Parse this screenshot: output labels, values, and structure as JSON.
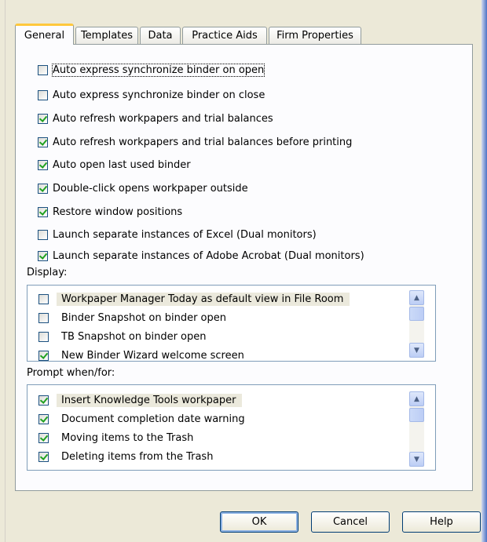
{
  "tabs": [
    {
      "label": "General",
      "active": true
    },
    {
      "label": "Templates",
      "active": false
    },
    {
      "label": "Data",
      "active": false
    },
    {
      "label": "Practice Aids",
      "active": false
    },
    {
      "label": "Firm Properties",
      "active": false
    }
  ],
  "options": [
    {
      "label": "Auto express synchronize binder on open",
      "checked": false
    },
    {
      "label": "Auto express synchronize binder on close",
      "checked": false
    },
    {
      "label": "Auto refresh workpapers and trial balances",
      "checked": true
    },
    {
      "label": "Auto refresh workpapers and trial balances before printing",
      "checked": true
    },
    {
      "label": "Auto open last used binder",
      "checked": true
    },
    {
      "label": "Double-click opens workpaper outside",
      "checked": true
    },
    {
      "label": "Restore window positions",
      "checked": true
    },
    {
      "label": "Launch separate instances of Excel (Dual monitors)",
      "checked": false
    },
    {
      "label": "Launch separate instances of Adobe Acrobat (Dual monitors)",
      "checked": true
    }
  ],
  "display": {
    "label": "Display:",
    "items": [
      {
        "label": "Workpaper Manager Today as default view in File Room",
        "checked": false
      },
      {
        "label": "Binder Snapshot on binder open",
        "checked": false
      },
      {
        "label": "TB Snapshot on binder open",
        "checked": false
      },
      {
        "label": "New Binder Wizard welcome screen",
        "checked": true
      }
    ]
  },
  "prompt": {
    "label": "Prompt when/for:",
    "items": [
      {
        "label": "Insert Knowledge Tools workpaper",
        "checked": true
      },
      {
        "label": "Document completion date warning",
        "checked": true
      },
      {
        "label": "Moving items to the Trash",
        "checked": true
      },
      {
        "label": "Deleting items from the Trash",
        "checked": true
      }
    ]
  },
  "buttons": {
    "ok": "OK",
    "cancel": "Cancel",
    "help": "Help"
  },
  "colors": {
    "dialog_bg": "#ece9d8",
    "panel_bg": "#fcfcfe",
    "check_green": "#21a121",
    "tab_highlight": "#ffc83c"
  }
}
